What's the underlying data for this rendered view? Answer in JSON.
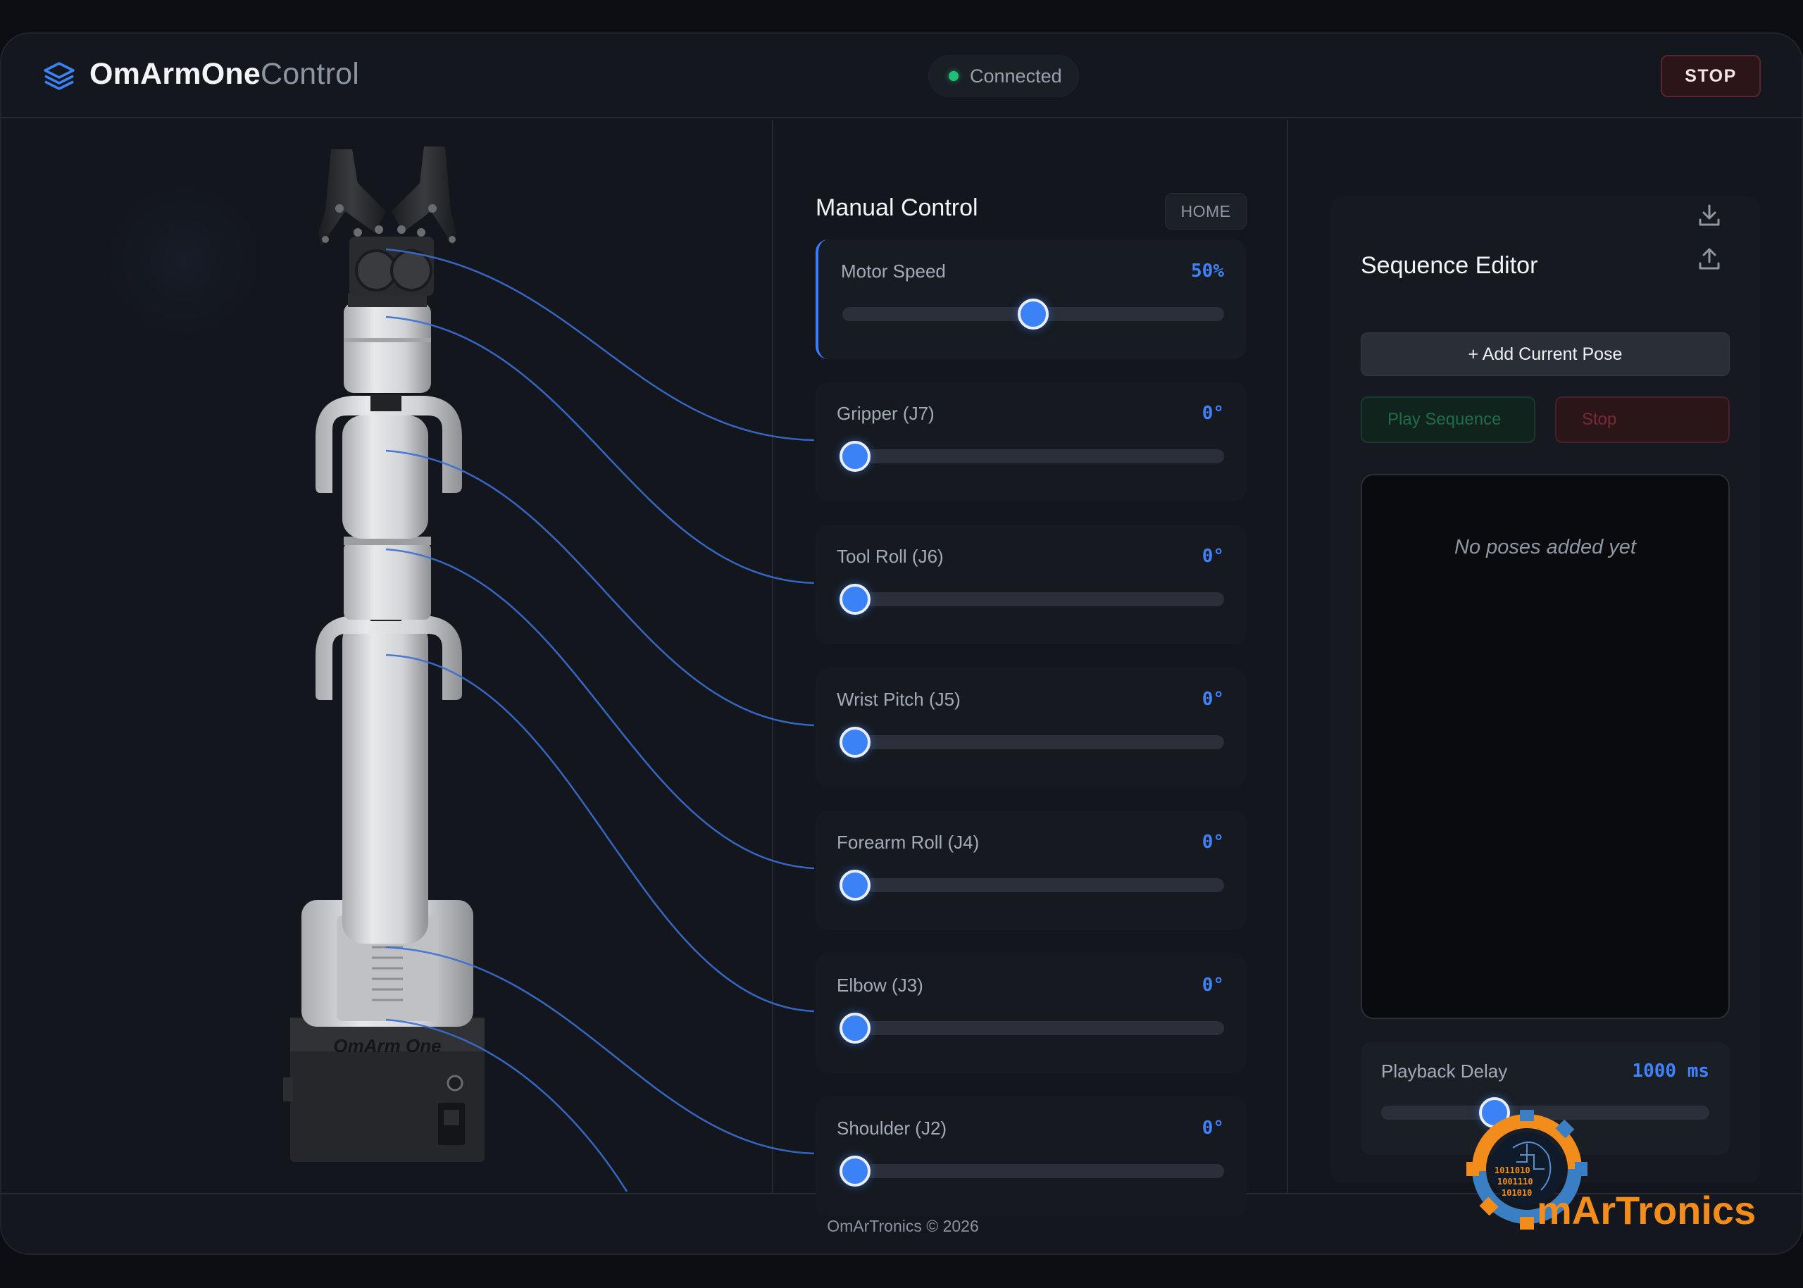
{
  "app": {
    "brand_bold": "OmArmOne",
    "brand_light": "Control",
    "connection_status": "Connected",
    "stop_label": "STOP"
  },
  "manual": {
    "title": "Manual Control",
    "home_label": "HOME",
    "controls": [
      {
        "id": "motor-speed",
        "label": "Motor Speed",
        "value": "50%",
        "fraction": 0.5
      },
      {
        "id": "gripper-j7",
        "label": "Gripper (J7)",
        "value": "0°",
        "fraction": 0.0
      },
      {
        "id": "tool-roll-j6",
        "label": "Tool Roll (J6)",
        "value": "0°",
        "fraction": 0.0
      },
      {
        "id": "wrist-pitch-j5",
        "label": "Wrist Pitch (J5)",
        "value": "0°",
        "fraction": 0.0
      },
      {
        "id": "forearm-roll-j4",
        "label": "Forearm Roll (J4)",
        "value": "0°",
        "fraction": 0.0
      },
      {
        "id": "elbow-j3",
        "label": "Elbow (J3)",
        "value": "0°",
        "fraction": 0.0
      },
      {
        "id": "shoulder-j2",
        "label": "Shoulder (J2)",
        "value": "0°",
        "fraction": 0.0
      }
    ]
  },
  "sequence": {
    "title": "Sequence Editor",
    "add_pose_label": "+ Add Current Pose",
    "play_label": "Play Sequence",
    "stop_label": "Stop",
    "empty_text": "No poses added yet",
    "delay_label": "Playback Delay",
    "delay_value": "1000 ms",
    "delay_fraction": 0.33,
    "download_icon": "download-icon",
    "upload_icon": "upload-icon"
  },
  "robot": {
    "base_text": "OmArm One"
  },
  "footer": {
    "copyright": "OmArTronics © 2026"
  },
  "watermark": {
    "logo_text": "mArTronics",
    "binary_text": [
      "1011010",
      "1001110",
      "101010"
    ]
  },
  "colors": {
    "accent": "#3b82f6",
    "connected": "#1fbf75",
    "stop": "#5a2530",
    "logo_orange": "#f28c1b",
    "logo_blue": "#3a7fc4"
  }
}
